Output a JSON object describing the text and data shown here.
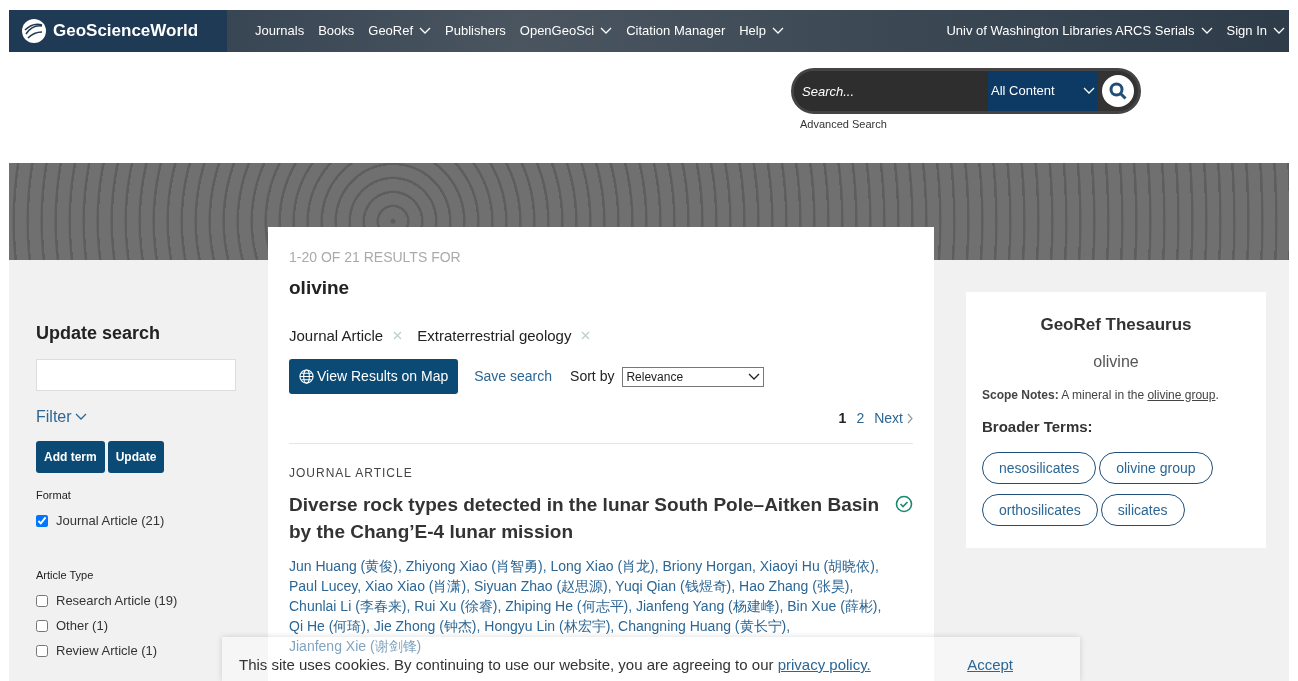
{
  "brand": "GeoScienceWorld",
  "nav": [
    {
      "label": "Journals",
      "dropdown": false
    },
    {
      "label": "Books",
      "dropdown": false
    },
    {
      "label": "GeoRef",
      "dropdown": true
    },
    {
      "label": "Publishers",
      "dropdown": false
    },
    {
      "label": "OpenGeoSci",
      "dropdown": true
    },
    {
      "label": "Citation Manager",
      "dropdown": false
    },
    {
      "label": "Help",
      "dropdown": true
    }
  ],
  "nav_right": [
    {
      "label": "Univ of Washington Libraries ARCS Serials",
      "dropdown": true
    },
    {
      "label": "Sign In",
      "dropdown": true
    }
  ],
  "search": {
    "placeholder": "Search...",
    "scope": "All Content",
    "advanced": "Advanced Search"
  },
  "sidebar": {
    "title": "Update search",
    "filter": "Filter",
    "buttons": [
      "Add term",
      "Update"
    ],
    "groups": [
      {
        "title": "Format",
        "options": [
          {
            "label": "Journal Article (21)",
            "checked": true
          }
        ]
      },
      {
        "title": "Article Type",
        "options": [
          {
            "label": "Research Article (19)",
            "checked": false
          },
          {
            "label": "Other (1)",
            "checked": false
          },
          {
            "label": "Review Article (1)",
            "checked": false
          }
        ]
      }
    ]
  },
  "results": {
    "count": "1-20 OF 21 RESULTS FOR",
    "query": "olivine",
    "facets": [
      "Journal Article",
      "Extraterrestrial geology"
    ],
    "map_button": "View Results on Map",
    "save": "Save search",
    "sort_label": "Sort by",
    "sort_value": "Relevance",
    "pages": [
      {
        "label": "1",
        "selected": true
      },
      {
        "label": "2",
        "selected": false
      }
    ],
    "next": "Next",
    "article": {
      "type": "JOURNAL ARTICLE",
      "title": "Diverse rock types detected in the lunar South Pole–Aitken Basin by the Chang’E-4 lunar mission",
      "open_access": true,
      "author_separator": ",",
      "authors": [
        "Jun Huang (黄俊)",
        "Zhiyong Xiao (肖智勇)",
        "Long Xiao (肖龙)",
        "Briony Horgan",
        "Xiaoyi Hu (胡晓依)",
        "Paul Lucey",
        "Xiao Xiao (肖潇)",
        "Siyuan Zhao (赵思源)",
        "Yuqi Qian (钱煜奇)",
        "Hao Zhang (张昊)",
        "Chunlai Li (李春来)",
        "Rui Xu (徐睿)",
        "Zhiping He (何志平)",
        "Jianfeng Yang (杨建峰)",
        "Bin Xue (薛彬)",
        "Qi He (何琦)",
        "Jie Zhong (钟杰)",
        "Hongyu Lin (林宏宇)",
        "Changning Huang (黄长宁)",
        "Jianfeng Xie (谢剑锋)"
      ]
    }
  },
  "thesaurus": {
    "title": "GeoRef Thesaurus",
    "term": "olivine",
    "scope_label": "Scope Notes:",
    "scope_text": "A mineral in the",
    "scope_link": "olivine group",
    "scope_end": ".",
    "broader_label": "Broader Terms:",
    "broader": [
      "nesosilicates",
      "olivine group",
      "orthosilicates",
      "silicates"
    ]
  },
  "cookie": {
    "text": "This site uses cookies. By continuing to use our website, you are agreeing to our",
    "link": "privacy policy.",
    "accept": "Accept"
  }
}
